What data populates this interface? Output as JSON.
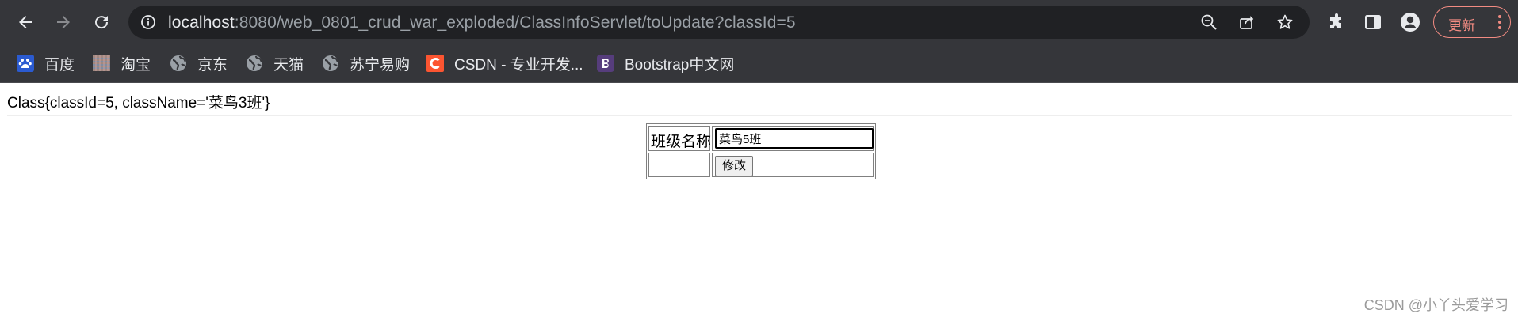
{
  "browser": {
    "url_host": "localhost",
    "url_rest": ":8080/web_0801_crud_war_exploded/ClassInfoServlet/toUpdate?classId=5",
    "update_label": "更新",
    "bookmarks": [
      {
        "label": "百度",
        "icon": "baidu-icon"
      },
      {
        "label": "淘宝",
        "icon": "taobao-icon"
      },
      {
        "label": "京东",
        "icon": "globe-icon"
      },
      {
        "label": "天猫",
        "icon": "globe-icon"
      },
      {
        "label": "苏宁易购",
        "icon": "globe-icon"
      },
      {
        "label": "CSDN - 专业开发...",
        "icon": "csdn-icon"
      },
      {
        "label": "Bootstrap中文网",
        "icon": "bootstrap-icon"
      }
    ]
  },
  "page": {
    "object_text": "Class{classId=5, className='菜鸟3班'}",
    "form": {
      "name_label": "班级名称",
      "name_value": "菜鸟5班",
      "submit_label": "修改"
    },
    "watermark": "CSDN @小丫头爱学习"
  },
  "colors": {
    "toolbar_bg": "#35363a",
    "omnibox_bg": "#202124",
    "update_accent": "#f28b82"
  }
}
